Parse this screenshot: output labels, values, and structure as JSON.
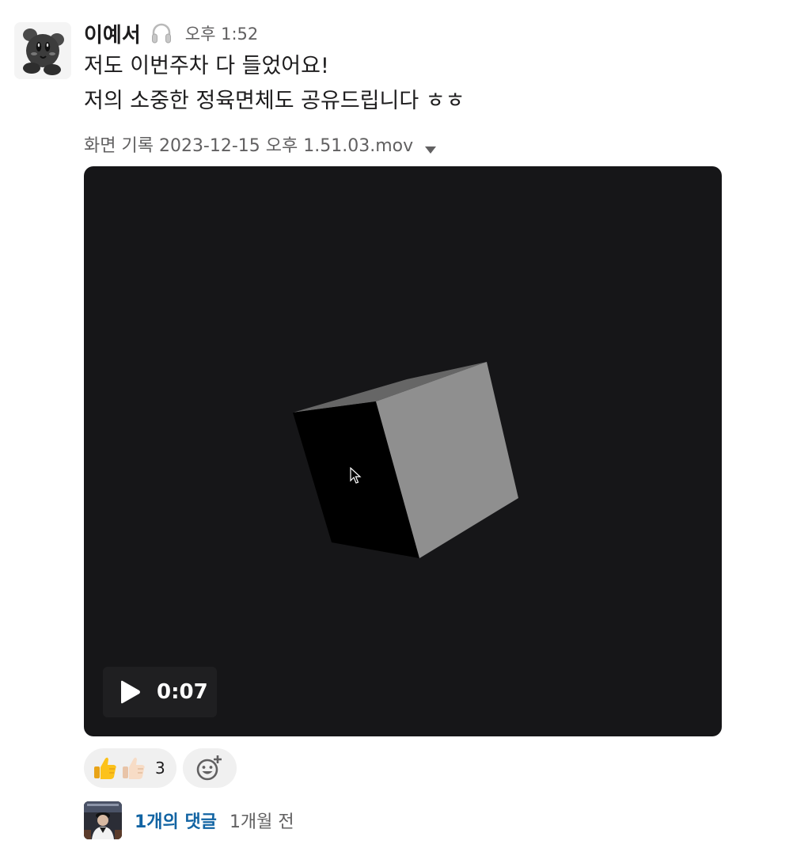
{
  "message": {
    "sender": "이예서",
    "status_icon": "headphones-icon",
    "timestamp": "오후 1:52",
    "lines": [
      "저도 이번주차 다 들었어요!",
      "저의 소중한 정육면체도 공유드립니다 ㅎㅎ"
    ]
  },
  "attachment": {
    "filename": "화면 기록 2023-12-15 오후 1.51.03.mov",
    "toggle_icon": "caret-down-icon",
    "video": {
      "duration": "0:07",
      "play_icon": "play-icon",
      "background_color": "#161618"
    }
  },
  "reactions": {
    "emojis": [
      "thumbs-up",
      "thumbs-up-light-skin-tone"
    ],
    "count": "3",
    "add_icon": "add-reaction-icon"
  },
  "thread": {
    "reply_count": "1개의 댓글",
    "last_reply": "1개월 전"
  },
  "colors": {
    "link": "#1264a3",
    "muted_text": "#616061",
    "pill_background": "#f0f0f0"
  }
}
